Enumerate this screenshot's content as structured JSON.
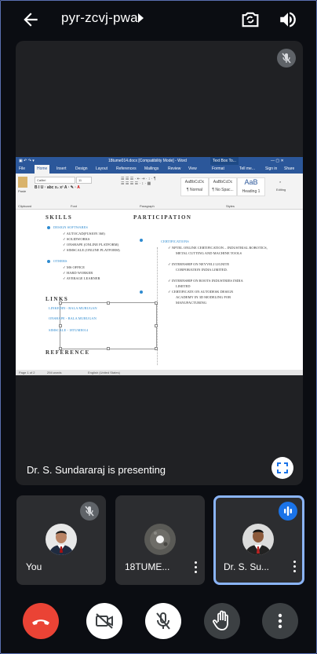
{
  "topbar": {
    "meeting_code": "pyr-zcvj-pwa",
    "back_icon": "arrow-back-icon",
    "switch_camera_icon": "switch-camera-icon",
    "speaker_icon": "volume-icon"
  },
  "stage": {
    "presenting_text": "Dr. S. Sundararaj is presenting"
  },
  "doc": {
    "window_title": "18tume014.docx [Compatibility Mode] - Word",
    "context_title": "Text Box To...",
    "tabs": [
      "File",
      "Home",
      "Insert",
      "Design",
      "Layout",
      "References",
      "Mailings",
      "Review",
      "View",
      "Format"
    ],
    "tell_me": "Tell me...",
    "sign_in": "Sign in",
    "share": "Share",
    "font_name": "Calibri",
    "font_size": "11",
    "paste_label": "Paste",
    "clipboard_label": "Clipboard",
    "font_label": "Font",
    "paragraph_label": "Paragraph",
    "styles_label": "Styles",
    "editing_label": "Editing",
    "styles": [
      {
        "preview": "AaBbCcDc",
        "name": "¶ Normal"
      },
      {
        "preview": "AaBbCcDc",
        "name": "¶ No Spac..."
      },
      {
        "preview": "AaB",
        "name": "Heading 1"
      }
    ],
    "skills_heading": "SKILLS",
    "participation_heading": "PARTICIPATION",
    "design_softwares": "DESIGN SOFTWARES",
    "skills_items": [
      "AUTOCAD(FUSION 360)",
      "SOLIDWORKS",
      "ONSHAPE  (ONLINE PLATFORM)",
      "SIMSCALE  (ONLINE PLATFORM)"
    ],
    "others": "OTHERS",
    "others_items": [
      "MS OFFICE",
      "HARD WORKER",
      "AVERAGE LEARNER"
    ],
    "certifications": "CERTIFICATIONS",
    "cert_items": [
      [
        "NPTEL ONLINE CERTIFICATION – INDUSTRIAL ROBOTICS,",
        "METAL CUTTING AND MACHINE TOOLS"
      ],
      [
        "INTERNSHIP ON NEYVELI LIGNITE",
        "CORPORATION INDIA LIMITED."
      ],
      [
        "INTERNSHIP ON ROOTS INDUSTRIES INDIA",
        "LIMITED"
      ],
      [
        "CERTIFICATE ON AUTODESK DESIGN",
        "ACADEMY IN 3D MODELING FOR",
        "MANUFACTURING"
      ]
    ],
    "links_heading": "LINKS",
    "links": [
      "LINKEDIN - BALA MURUGAN",
      "ONSHAPE - BALA MURUGAN",
      "SIMSCALE - 18TUME014"
    ],
    "reference_heading": "REFERENCE",
    "status_page": "Page 1 of 2",
    "status_words": "294 words",
    "status_lang": "English (United States)"
  },
  "tiles": [
    {
      "name": "You",
      "muted": true
    },
    {
      "name": "18TUME...",
      "muted": false
    },
    {
      "name": "Dr. S. Su...",
      "speaking": true
    }
  ],
  "controls": [
    "end-call",
    "camera-off",
    "mic-off",
    "raise-hand",
    "more-options"
  ],
  "colors": {
    "end_call": "#ea4335",
    "speaking_border": "#8ab4f8",
    "speaking_badge": "#1a73e8",
    "tile_bg": "#2c2d30",
    "stage_bg": "#202124",
    "word_blue": "#2b579a",
    "doc_accent": "#2e8bd0"
  }
}
